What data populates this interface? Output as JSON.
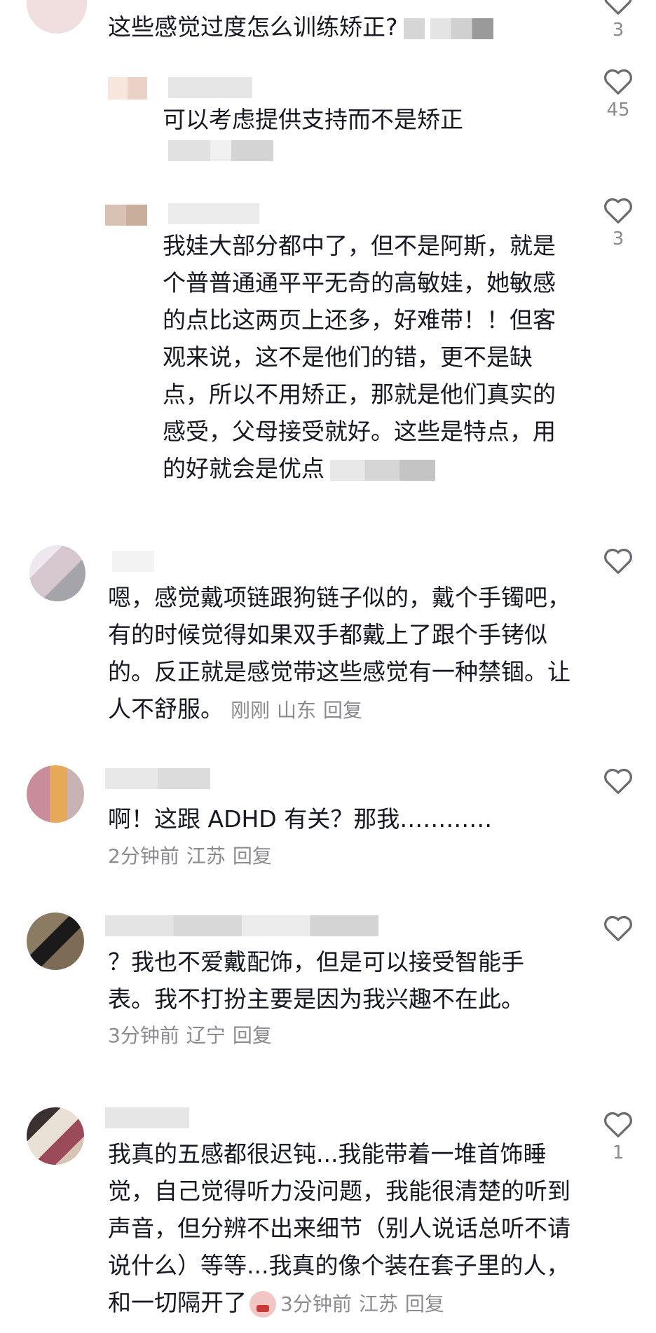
{
  "comments": [
    {
      "text": "这些感觉过度怎么训练矫正?",
      "meta": {
        "time": "",
        "location": "",
        "reply": ""
      },
      "likes": "3"
    },
    {
      "text": "可以考虑提供支持而不是矫正",
      "meta": {
        "time": "",
        "location": "",
        "reply": ""
      },
      "likes": "45"
    },
    {
      "text": "我娃大部分都中了，但不是阿斯，就是个普普通通平平无奇的高敏娃，她敏感的点比这两页上还多，好难带！！但客观来说，这不是他们的错，更不是缺点，所以不用矫正，那就是他们真实的感受，父母接受就好。这些是特点，用的好就会是优点",
      "meta": {
        "time": "",
        "location": "",
        "reply": ""
      },
      "likes": "3"
    },
    {
      "text": "嗯，感觉戴项链跟狗链子似的，戴个手镯吧，有的时候觉得如果双手都戴上了跟个手铐似的。反正就是感觉带这些感觉有一种禁锢。让人不舒服。",
      "meta": {
        "time": "刚刚",
        "location": "山东",
        "reply": "回复"
      },
      "likes": ""
    },
    {
      "text": "啊！这跟 ADHD 有关？那我…………",
      "meta": {
        "time": "2分钟前",
        "location": "江苏",
        "reply": "回复"
      },
      "likes": ""
    },
    {
      "text": "？我也不爱戴配饰，但是可以接受智能手表。我不打扮主要是因为我兴趣不在此。",
      "meta": {
        "time": "3分钟前",
        "location": "辽宁",
        "reply": "回复"
      },
      "likes": ""
    },
    {
      "text": "我真的五感都很迟钝...我能带着一堆首饰睡觉，自己觉得听力没问题，我能很清楚的听到声音，但分辨不出来细节（别人说话总听不请说什么）等等...我真的像个装在套子里的人，和一切隔开了",
      "meta": {
        "time": "3分钟前",
        "location": "江苏",
        "reply": "回复"
      },
      "likes": "1"
    }
  ],
  "colors": {
    "text": "#161823",
    "meta": "#8a8b91",
    "icon": "#6b6c72"
  },
  "icons": {
    "like": "heart-outline-icon",
    "emoji": "crying-face-emoji"
  }
}
